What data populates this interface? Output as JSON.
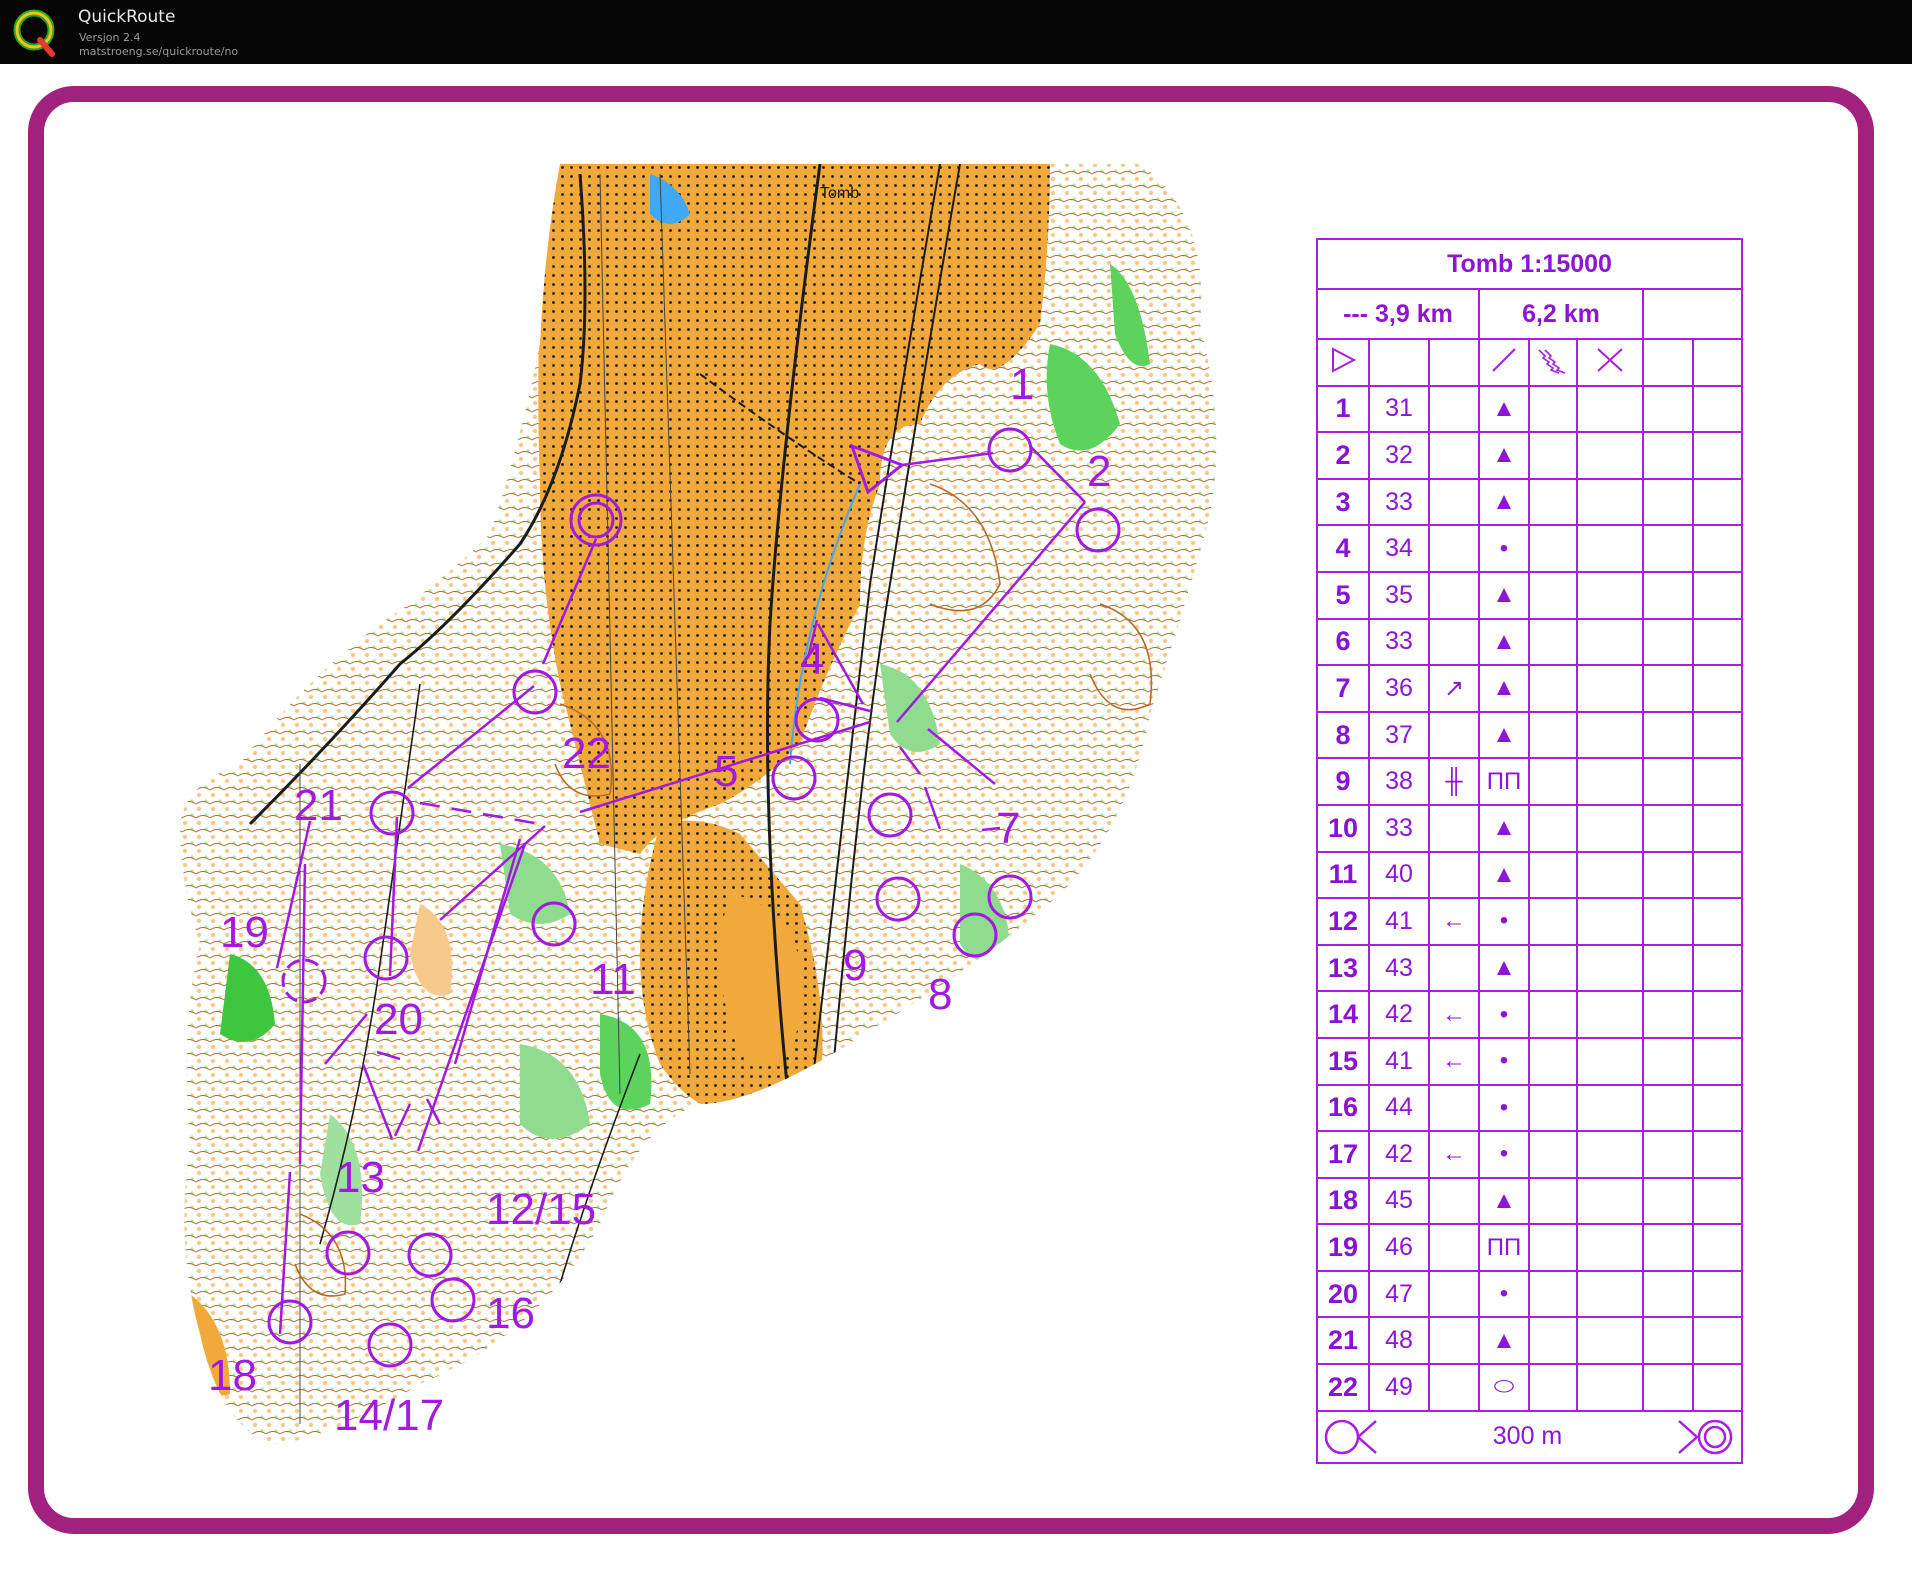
{
  "app": {
    "title": "QuickRoute",
    "version": "Versjon 2.4",
    "url": "matstroeng.se/quickroute/no"
  },
  "colors": {
    "frame": "#a0217e",
    "course": "#a21ae0",
    "open_land": "#f2a93b",
    "forest_green": "#5cd35c",
    "legend_text": "#8d16d6"
  },
  "map": {
    "town_label": "Tomb",
    "control_labels": [
      "1",
      "2",
      "4",
      "5",
      "7",
      "8",
      "9",
      "11",
      "12/15",
      "13",
      "14/17",
      "16",
      "18",
      "19",
      "20",
      "21",
      "22"
    ]
  },
  "legend": {
    "title": "Tomb 1:15000",
    "length_short": "--- 3,9 km",
    "length_long": "6,2 km",
    "header_icons": [
      "start-triangle-icon",
      "slash-icon",
      "zigzag-icon",
      "cross-icon"
    ],
    "rows": [
      {
        "n": "1",
        "code": "31",
        "dir": "",
        "sym": "▲"
      },
      {
        "n": "2",
        "code": "32",
        "dir": "",
        "sym": "▲"
      },
      {
        "n": "3",
        "code": "33",
        "dir": "",
        "sym": "▲"
      },
      {
        "n": "4",
        "code": "34",
        "dir": "",
        "sym": "•"
      },
      {
        "n": "5",
        "code": "35",
        "dir": "",
        "sym": "▲"
      },
      {
        "n": "6",
        "code": "33",
        "dir": "",
        "sym": "▲"
      },
      {
        "n": "7",
        "code": "36",
        "dir": "↗",
        "sym": "▲"
      },
      {
        "n": "8",
        "code": "37",
        "dir": "",
        "sym": "▲"
      },
      {
        "n": "9",
        "code": "38",
        "dir": "╫",
        "sym": "ПП"
      },
      {
        "n": "10",
        "code": "33",
        "dir": "",
        "sym": "▲"
      },
      {
        "n": "11",
        "code": "40",
        "dir": "",
        "sym": "▲"
      },
      {
        "n": "12",
        "code": "41",
        "dir": "←",
        "sym": "•"
      },
      {
        "n": "13",
        "code": "43",
        "dir": "",
        "sym": "▲"
      },
      {
        "n": "14",
        "code": "42",
        "dir": "←",
        "sym": "•"
      },
      {
        "n": "15",
        "code": "41",
        "dir": "←",
        "sym": "•"
      },
      {
        "n": "16",
        "code": "44",
        "dir": "",
        "sym": "•"
      },
      {
        "n": "17",
        "code": "42",
        "dir": "←",
        "sym": "•"
      },
      {
        "n": "18",
        "code": "45",
        "dir": "",
        "sym": "▲"
      },
      {
        "n": "19",
        "code": "46",
        "dir": "",
        "sym": "ПП"
      },
      {
        "n": "20",
        "code": "47",
        "dir": "",
        "sym": "•"
      },
      {
        "n": "21",
        "code": "48",
        "dir": "",
        "sym": "▲"
      },
      {
        "n": "22",
        "code": "49",
        "dir": "",
        "sym": "⬭"
      }
    ],
    "footer_distance": "300 m"
  }
}
